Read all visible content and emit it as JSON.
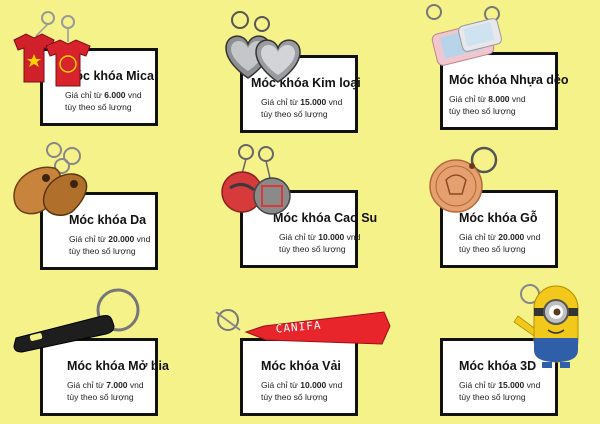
{
  "products": [
    {
      "name": "Móc khóa Mica",
      "price_prefix": "Giá chỉ từ",
      "price": "6.000",
      "unit": "vnd",
      "note": "tùy theo số lượng",
      "icon": "tshirt-keychain-icon"
    },
    {
      "name": "Móc khóa Kim loại",
      "price_prefix": "Giá chỉ từ",
      "price": "15.000",
      "unit": "vnd",
      "note": "tùy theo số lượng",
      "icon": "metal-heart-keychain-icon"
    },
    {
      "name": "Móc khóa Nhựa dẻo",
      "price_prefix": "Giá chỉ từ",
      "price": "8.000",
      "unit": "vnd",
      "note": "tùy theo số lượng",
      "icon": "phone-keychain-icon"
    },
    {
      "name": "Móc khóa Da",
      "price_prefix": "Giá chỉ từ",
      "price": "20.000",
      "unit": "vnd",
      "note": "tùy theo số lượng",
      "icon": "leather-keychain-icon"
    },
    {
      "name": "Móc khóa Cao Su",
      "price_prefix": "Giá chỉ từ",
      "price": "10.000",
      "unit": "vnd",
      "note": "tùy theo số lượng",
      "icon": "rubber-keychain-icon"
    },
    {
      "name": "Móc khóa Gỗ",
      "price_prefix": "Giá chỉ từ",
      "price": "20.000",
      "unit": "vnd",
      "note": "tùy theo số lượng",
      "icon": "wood-keychain-icon"
    },
    {
      "name": "Móc khóa Mở bia",
      "price_prefix": "Giá chỉ từ",
      "price": "7.000",
      "unit": "vnd",
      "note": "tùy theo số lượng",
      "icon": "bottle-opener-keychain-icon"
    },
    {
      "name": "Móc khóa Vải",
      "price_prefix": "Giá chỉ từ",
      "price": "10.000",
      "unit": "vnd",
      "note": "tùy theo số lượng",
      "icon": "fabric-strap-keychain-icon"
    },
    {
      "name": "Móc khóa 3D",
      "price_prefix": "Giá chỉ từ",
      "price": "15.000",
      "unit": "vnd",
      "note": "tùy theo số lượng",
      "icon": "minion-keychain-icon"
    }
  ],
  "strap_text": "CANIFA",
  "colors": {
    "background": "#f6f28a",
    "card_border": "#111111",
    "card_fill": "#ffffff"
  }
}
